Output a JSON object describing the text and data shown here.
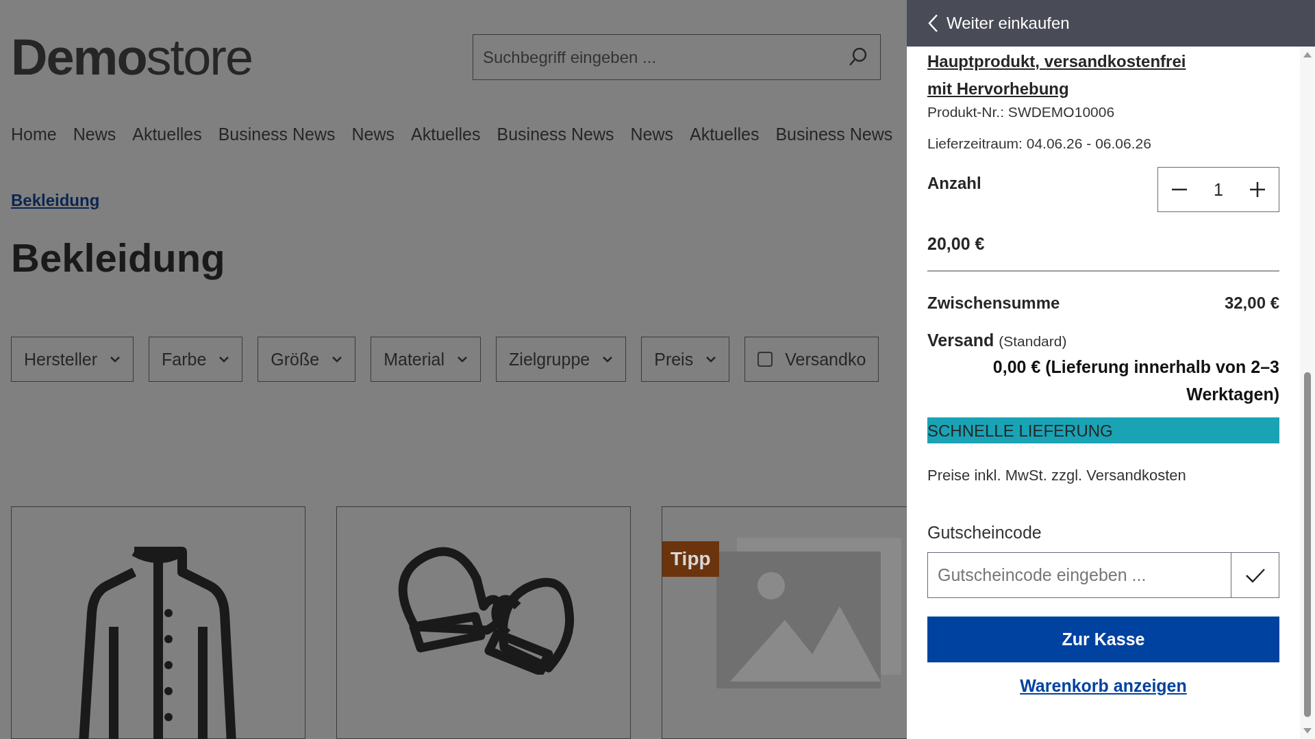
{
  "header": {
    "logo": {
      "bold": "Demo",
      "light": "store"
    },
    "search": {
      "placeholder": "Suchbegriff eingeben ..."
    }
  },
  "nav": [
    "Home",
    "News",
    "Aktuelles",
    "Business News",
    "News",
    "Aktuelles",
    "Business News",
    "News",
    "Aktuelles",
    "Business News"
  ],
  "breadcrumb": "Bekleidung",
  "title": "Bekleidung",
  "filters": [
    {
      "label": "Hersteller",
      "kind": "dropdown"
    },
    {
      "label": "Farbe",
      "kind": "dropdown"
    },
    {
      "label": "Größe",
      "kind": "dropdown"
    },
    {
      "label": "Material",
      "kind": "dropdown"
    },
    {
      "label": "Zielgruppe",
      "kind": "dropdown"
    },
    {
      "label": "Preis",
      "kind": "dropdown"
    },
    {
      "label": "Versandko",
      "kind": "checkbox",
      "checked": false
    }
  ],
  "products": [
    {
      "kind": "jacket"
    },
    {
      "kind": "mittens"
    },
    {
      "kind": "placeholder",
      "badge": "Tipp"
    }
  ],
  "cart": {
    "back": "Weiter einkaufen",
    "item": {
      "name": "Hauptprodukt, versandkostenfrei mit Hervorhebung",
      "number": "Produkt-Nr.: SWDEMO10006",
      "delivery": "Lieferzeitraum: 04.06.26 - 06.06.26",
      "quantity_label": "Anzahl",
      "quantity": "1",
      "price": "20,00 €"
    },
    "subtotal": {
      "label": "Zwischensumme",
      "value": "32,00 €"
    },
    "shipping": {
      "label": "Versand",
      "method": "(Standard)",
      "value": "0,00 € (Lieferung innerhalb von 2–3 Werktagen)"
    },
    "badge": "SCHNELLE LIEFERUNG",
    "tax_note": "Preise inkl. MwSt. zzgl. Versandkosten",
    "voucher": {
      "label": "Gutscheincode",
      "placeholder": "Gutscheincode eingeben ..."
    },
    "checkout": "Zur Kasse",
    "cart_link": "Warenkorb anzeigen"
  }
}
